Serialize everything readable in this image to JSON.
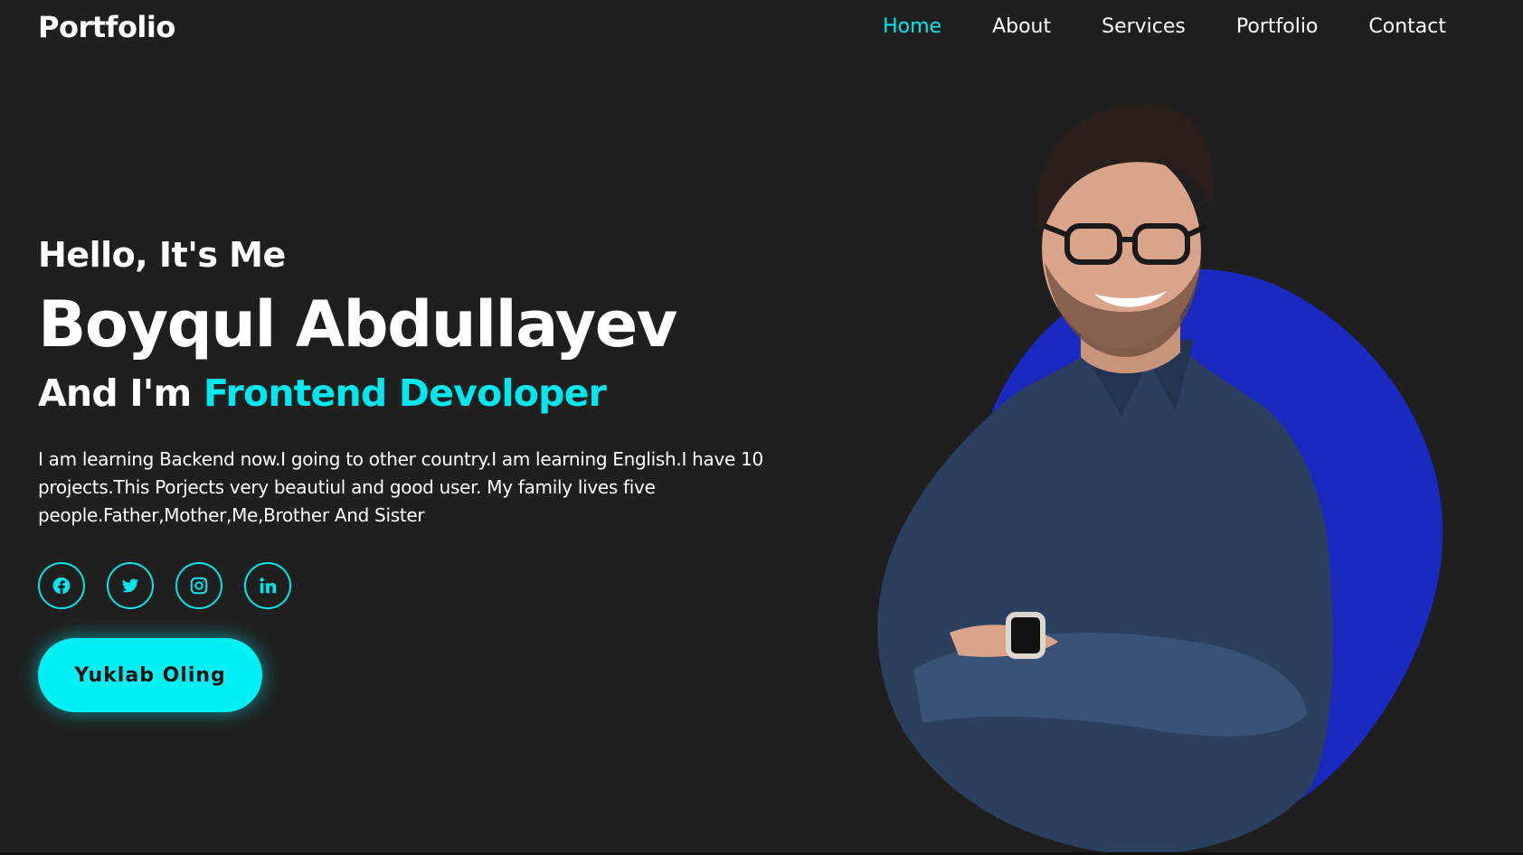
{
  "header": {
    "logo": "Portfolio",
    "nav": [
      {
        "label": "Home",
        "active": true
      },
      {
        "label": "About",
        "active": false
      },
      {
        "label": "Services",
        "active": false
      },
      {
        "label": "Portfolio",
        "active": false
      },
      {
        "label": "Contact",
        "active": false
      }
    ]
  },
  "hero": {
    "greeting": "Hello, It's Me",
    "name": "Boyqul Abdullayev",
    "role_prefix": "And I'm ",
    "role_highlight": "Frontend Devoloper",
    "description": "I am learning Backend now.I going to other country.I am learning English.I have 10 projects.This Porjects very beautiul and good user. My family lives five people.Father,Mother,Me,Brother And Sister",
    "socials": [
      {
        "icon": "facebook-icon"
      },
      {
        "icon": "twitter-icon"
      },
      {
        "icon": "instagram-icon"
      },
      {
        "icon": "linkedin-icon"
      }
    ],
    "cta_label": "Yuklab Oling"
  },
  "colors": {
    "background": "#1f1f1f",
    "accent": "#00e8ee",
    "blob": "#1a2ac0",
    "shirt": "#2b3f5f"
  }
}
